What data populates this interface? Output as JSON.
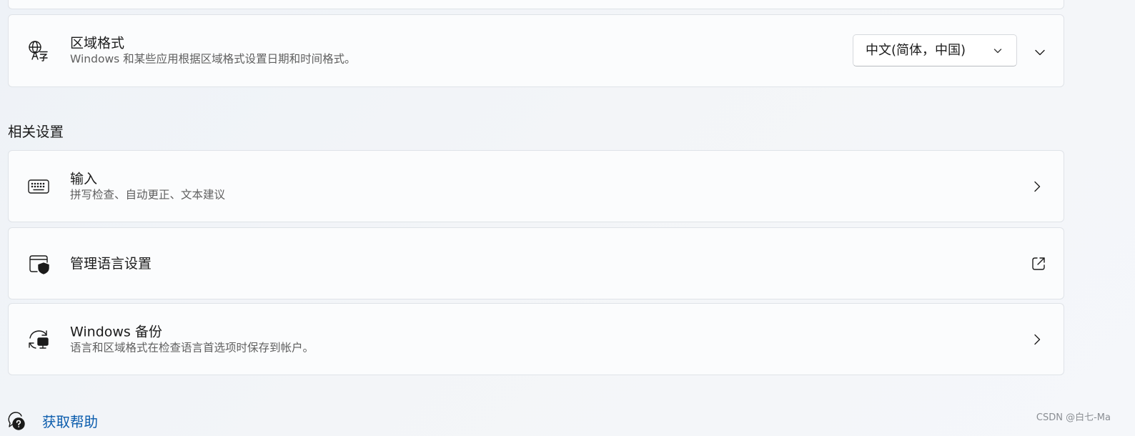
{
  "region_format": {
    "title": "区域格式",
    "description": "Windows 和某些应用根据区域格式设置日期和时间格式。",
    "dropdown_value": "中文(简体，中国)",
    "icon": "language-region-icon"
  },
  "related_settings": {
    "heading": "相关设置",
    "items": [
      {
        "title": "输入",
        "description": "拼写检查、自动更正、文本建议",
        "icon": "keyboard-icon",
        "action_icon": "chevron-right-icon"
      },
      {
        "title": "管理语言设置",
        "description": "",
        "icon": "admin-shield-window-icon",
        "action_icon": "open-external-icon"
      },
      {
        "title": "Windows 备份",
        "description": "语言和区域格式在检查语言首选项时保存到帐户。",
        "icon": "backup-sync-icon",
        "action_icon": "chevron-right-icon"
      }
    ]
  },
  "help": {
    "label": "获取帮助",
    "icon": "help-chat-icon"
  },
  "watermark": "CSDN @白七-Ma",
  "colors": {
    "link": "#0b5cad",
    "card_background": "#fbfcfd",
    "page_background": "#f3f5f8"
  }
}
